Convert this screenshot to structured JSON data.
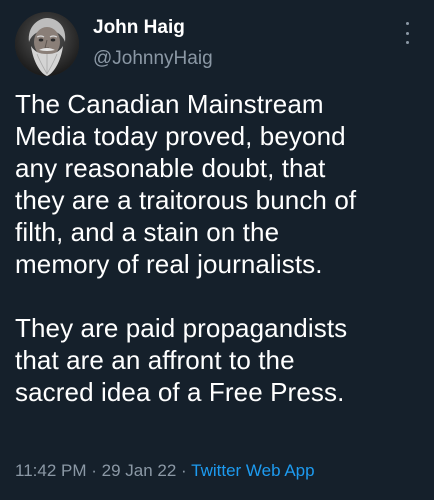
{
  "author": {
    "name": "John Haig",
    "handle": "@JohnnyHaig",
    "avatar_icon": "bearded-man-avatar"
  },
  "tweet": {
    "text": "The Canadian Mainstream\nMedia today proved, beyond\nany reasonable doubt, that\nthey are a traitorous bunch of\nfilth, and a stain on the\nmemory of real journalists.\n\nThey are paid propagandists\nthat are an affront to the\nsacred idea of a Free Press."
  },
  "meta": {
    "time": "11:42 PM",
    "separator": " · ",
    "date": "29 Jan 22",
    "app": "Twitter Web App"
  },
  "colors": {
    "background": "#15202b",
    "text": "#ffffff",
    "muted": "#8b98a5",
    "accent": "#1d9bf0"
  },
  "menu": {
    "icon": "more-vertical-icon"
  }
}
